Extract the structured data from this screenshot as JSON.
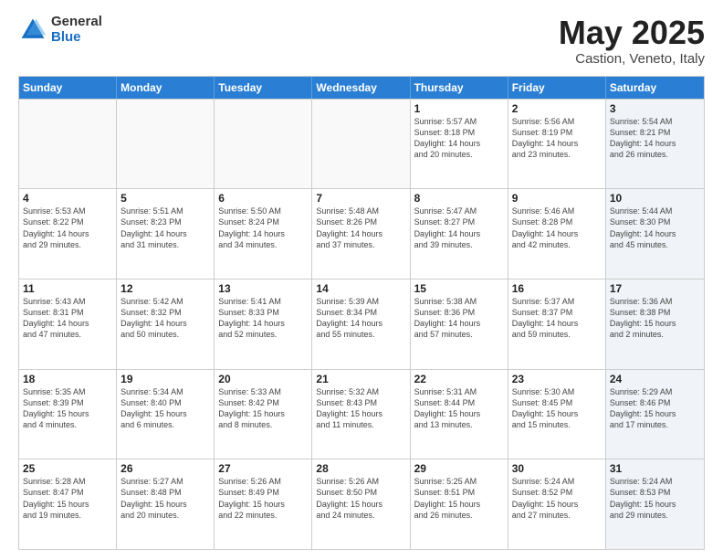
{
  "logo": {
    "general": "General",
    "blue": "Blue"
  },
  "title": {
    "main": "May 2025",
    "sub": "Castion, Veneto, Italy"
  },
  "header_days": [
    "Sunday",
    "Monday",
    "Tuesday",
    "Wednesday",
    "Thursday",
    "Friday",
    "Saturday"
  ],
  "weeks": [
    [
      {
        "num": "",
        "info": "",
        "empty": true
      },
      {
        "num": "",
        "info": "",
        "empty": true
      },
      {
        "num": "",
        "info": "",
        "empty": true
      },
      {
        "num": "",
        "info": "",
        "empty": true
      },
      {
        "num": "1",
        "info": "Sunrise: 5:57 AM\nSunset: 8:18 PM\nDaylight: 14 hours\nand 20 minutes."
      },
      {
        "num": "2",
        "info": "Sunrise: 5:56 AM\nSunset: 8:19 PM\nDaylight: 14 hours\nand 23 minutes."
      },
      {
        "num": "3",
        "info": "Sunrise: 5:54 AM\nSunset: 8:21 PM\nDaylight: 14 hours\nand 26 minutes.",
        "shaded": true
      }
    ],
    [
      {
        "num": "4",
        "info": "Sunrise: 5:53 AM\nSunset: 8:22 PM\nDaylight: 14 hours\nand 29 minutes."
      },
      {
        "num": "5",
        "info": "Sunrise: 5:51 AM\nSunset: 8:23 PM\nDaylight: 14 hours\nand 31 minutes."
      },
      {
        "num": "6",
        "info": "Sunrise: 5:50 AM\nSunset: 8:24 PM\nDaylight: 14 hours\nand 34 minutes."
      },
      {
        "num": "7",
        "info": "Sunrise: 5:48 AM\nSunset: 8:26 PM\nDaylight: 14 hours\nand 37 minutes."
      },
      {
        "num": "8",
        "info": "Sunrise: 5:47 AM\nSunset: 8:27 PM\nDaylight: 14 hours\nand 39 minutes."
      },
      {
        "num": "9",
        "info": "Sunrise: 5:46 AM\nSunset: 8:28 PM\nDaylight: 14 hours\nand 42 minutes."
      },
      {
        "num": "10",
        "info": "Sunrise: 5:44 AM\nSunset: 8:30 PM\nDaylight: 14 hours\nand 45 minutes.",
        "shaded": true
      }
    ],
    [
      {
        "num": "11",
        "info": "Sunrise: 5:43 AM\nSunset: 8:31 PM\nDaylight: 14 hours\nand 47 minutes."
      },
      {
        "num": "12",
        "info": "Sunrise: 5:42 AM\nSunset: 8:32 PM\nDaylight: 14 hours\nand 50 minutes."
      },
      {
        "num": "13",
        "info": "Sunrise: 5:41 AM\nSunset: 8:33 PM\nDaylight: 14 hours\nand 52 minutes."
      },
      {
        "num": "14",
        "info": "Sunrise: 5:39 AM\nSunset: 8:34 PM\nDaylight: 14 hours\nand 55 minutes."
      },
      {
        "num": "15",
        "info": "Sunrise: 5:38 AM\nSunset: 8:36 PM\nDaylight: 14 hours\nand 57 minutes."
      },
      {
        "num": "16",
        "info": "Sunrise: 5:37 AM\nSunset: 8:37 PM\nDaylight: 14 hours\nand 59 minutes."
      },
      {
        "num": "17",
        "info": "Sunrise: 5:36 AM\nSunset: 8:38 PM\nDaylight: 15 hours\nand 2 minutes.",
        "shaded": true
      }
    ],
    [
      {
        "num": "18",
        "info": "Sunrise: 5:35 AM\nSunset: 8:39 PM\nDaylight: 15 hours\nand 4 minutes."
      },
      {
        "num": "19",
        "info": "Sunrise: 5:34 AM\nSunset: 8:40 PM\nDaylight: 15 hours\nand 6 minutes."
      },
      {
        "num": "20",
        "info": "Sunrise: 5:33 AM\nSunset: 8:42 PM\nDaylight: 15 hours\nand 8 minutes."
      },
      {
        "num": "21",
        "info": "Sunrise: 5:32 AM\nSunset: 8:43 PM\nDaylight: 15 hours\nand 11 minutes."
      },
      {
        "num": "22",
        "info": "Sunrise: 5:31 AM\nSunset: 8:44 PM\nDaylight: 15 hours\nand 13 minutes."
      },
      {
        "num": "23",
        "info": "Sunrise: 5:30 AM\nSunset: 8:45 PM\nDaylight: 15 hours\nand 15 minutes."
      },
      {
        "num": "24",
        "info": "Sunrise: 5:29 AM\nSunset: 8:46 PM\nDaylight: 15 hours\nand 17 minutes.",
        "shaded": true
      }
    ],
    [
      {
        "num": "25",
        "info": "Sunrise: 5:28 AM\nSunset: 8:47 PM\nDaylight: 15 hours\nand 19 minutes."
      },
      {
        "num": "26",
        "info": "Sunrise: 5:27 AM\nSunset: 8:48 PM\nDaylight: 15 hours\nand 20 minutes."
      },
      {
        "num": "27",
        "info": "Sunrise: 5:26 AM\nSunset: 8:49 PM\nDaylight: 15 hours\nand 22 minutes."
      },
      {
        "num": "28",
        "info": "Sunrise: 5:26 AM\nSunset: 8:50 PM\nDaylight: 15 hours\nand 24 minutes."
      },
      {
        "num": "29",
        "info": "Sunrise: 5:25 AM\nSunset: 8:51 PM\nDaylight: 15 hours\nand 26 minutes."
      },
      {
        "num": "30",
        "info": "Sunrise: 5:24 AM\nSunset: 8:52 PM\nDaylight: 15 hours\nand 27 minutes."
      },
      {
        "num": "31",
        "info": "Sunrise: 5:24 AM\nSunset: 8:53 PM\nDaylight: 15 hours\nand 29 minutes.",
        "shaded": true
      }
    ]
  ]
}
